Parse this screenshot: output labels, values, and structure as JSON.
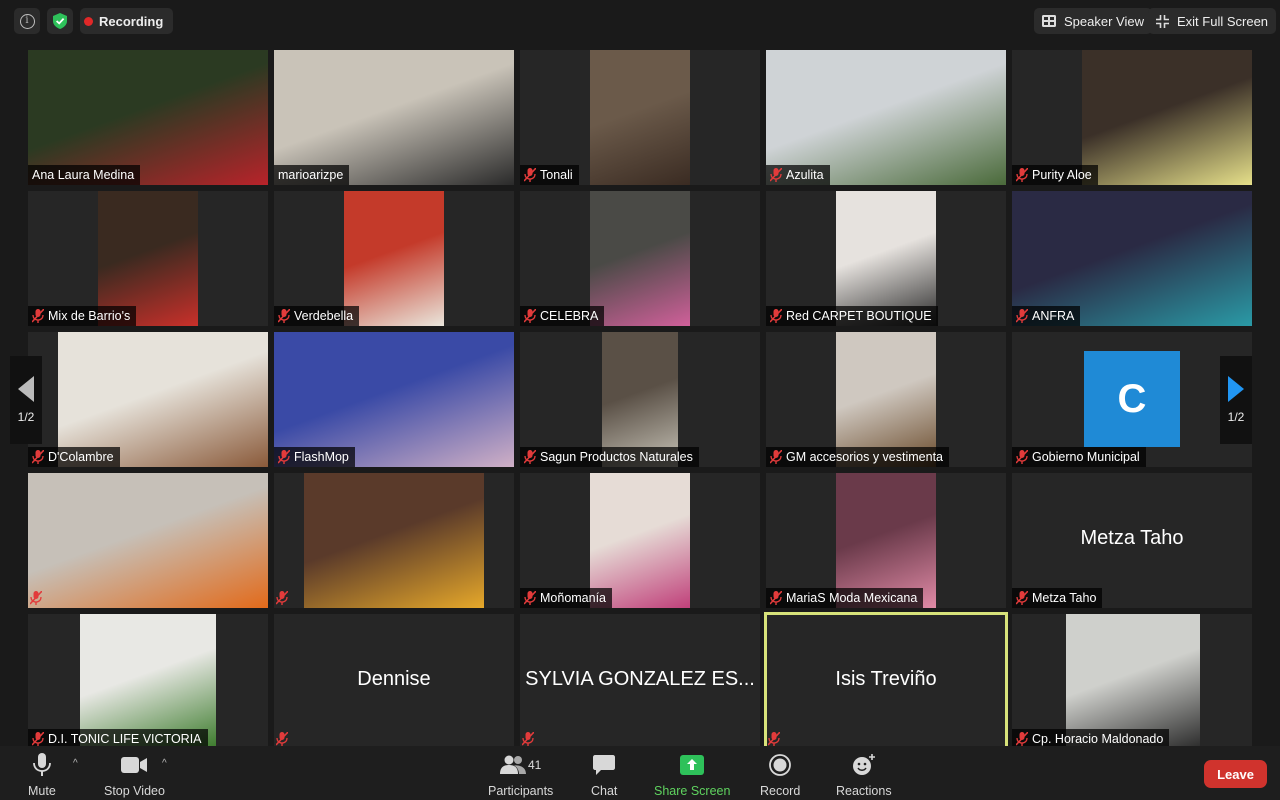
{
  "topbar": {
    "recording_label": "Recording",
    "speaker_view_label": "Speaker View",
    "exit_full_screen_label": "Exit Full Screen"
  },
  "pagination": {
    "left": "1/2",
    "right": "1/2"
  },
  "participants_grid": [
    {
      "name": "Ana Laura Medina",
      "muted": false,
      "video": true,
      "bg": "#2b3a22",
      "fg": "#b8232a"
    },
    {
      "name": "marioarizpe",
      "muted": false,
      "video": true,
      "bg": "#c9c3b8",
      "fg": "#2a2a2a"
    },
    {
      "name": "Tonali",
      "muted": true,
      "video": true,
      "bg": "#6b5a4a",
      "fg": "#3a2b22"
    },
    {
      "name": "Azulita",
      "muted": true,
      "video": true,
      "bg": "#cfd3d6",
      "fg": "#4a6a3a"
    },
    {
      "name": "Purity Aloe",
      "muted": true,
      "video": true,
      "bg": "#3b3028",
      "fg": "#e6e08a"
    },
    {
      "name": "Mix de Barrio's",
      "muted": true,
      "video": true,
      "bg": "#3a2a20",
      "fg": "#c9302a"
    },
    {
      "name": "Verdebella",
      "muted": true,
      "video": true,
      "bg": "#c43a2a",
      "fg": "#eae6dc"
    },
    {
      "name": "CELEBRA",
      "muted": true,
      "video": true,
      "bg": "#4a4a46",
      "fg": "#d0609a"
    },
    {
      "name": "Red CARPET BOUTIQUE",
      "muted": true,
      "video": true,
      "bg": "#e6e2de",
      "fg": "#2a2a2a"
    },
    {
      "name": "ANFRA",
      "muted": true,
      "video": true,
      "bg": "#2a2a44",
      "fg": "#2a9aa6"
    },
    {
      "name": "D'Colambre",
      "muted": true,
      "video": true,
      "bg": "#e6e2da",
      "fg": "#8a5a3a"
    },
    {
      "name": "FlashMop",
      "muted": true,
      "video": true,
      "bg": "#3a4aa6",
      "fg": "#d0b0c6"
    },
    {
      "name": "Sagun Productos Naturales",
      "muted": true,
      "video": true,
      "bg": "#5a5046",
      "fg": "#c6c2b6"
    },
    {
      "name": "GM accesorios y vestimenta",
      "muted": true,
      "video": true,
      "bg": "#cfc8c0",
      "fg": "#6a4a2a"
    },
    {
      "name": "Gobierno Municipal",
      "muted": true,
      "video": false,
      "avatar_letter": "C",
      "avatar_color": "#1f8ad6"
    },
    {
      "name": "",
      "muted": true,
      "video": true,
      "bg": "#c6c0b8",
      "fg": "#e26a1a"
    },
    {
      "name": "",
      "muted": true,
      "video": true,
      "bg": "#5a3a2a",
      "fg": "#e6a82a"
    },
    {
      "name": "Moñomanía",
      "muted": true,
      "video": true,
      "bg": "#e6dcd6",
      "fg": "#c0407a"
    },
    {
      "name": "MariaS Moda Mexicana",
      "muted": true,
      "video": true,
      "bg": "#6a3a4a",
      "fg": "#e08aa6"
    },
    {
      "name": "Metza Taho",
      "muted": true,
      "video": false,
      "big_name": "Metza Taho"
    },
    {
      "name": "D.I. TONIC LIFE VICTORIA",
      "muted": true,
      "video": true,
      "bg": "#e8e8e4",
      "fg": "#3a7a2a"
    },
    {
      "name": "",
      "muted": true,
      "video": false,
      "big_name": "Dennise"
    },
    {
      "name": "",
      "muted": true,
      "video": false,
      "big_name": "SYLVIA GONZALEZ ES..."
    },
    {
      "name": "",
      "muted": true,
      "video": false,
      "big_name": "Isis Treviño",
      "active": true
    },
    {
      "name": "Cp. Horacio Maldonado",
      "muted": true,
      "video": true,
      "bg": "#cfd0cc",
      "fg": "#2a2a2a"
    }
  ],
  "toolbar": {
    "mute_label": "Mute",
    "stop_video_label": "Stop Video",
    "participants_label": "Participants",
    "participants_count": "41",
    "chat_label": "Chat",
    "share_screen_label": "Share Screen",
    "record_label": "Record",
    "reactions_label": "Reactions",
    "leave_label": "Leave"
  },
  "colors": {
    "share_green": "#2ec15a",
    "leave_red": "#d0332d",
    "active_speaker_outline": "#d7e27a",
    "nav_arrow": "#2196f3"
  }
}
